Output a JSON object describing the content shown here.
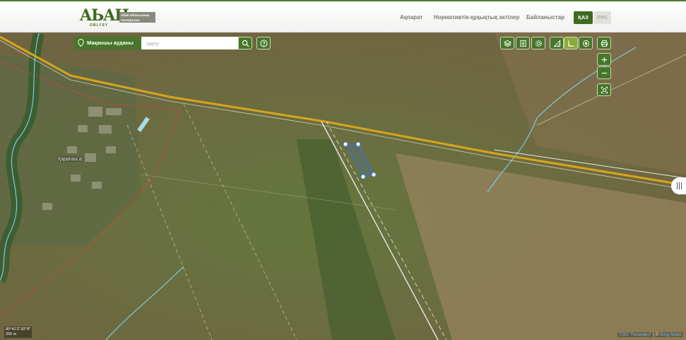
{
  "header": {
    "logo_mark": "AЬAH",
    "logo_sub": "OBLYSY",
    "logo_tag": "Абай облысының геопорталы",
    "nav": [
      "Ақпарат",
      "Нормативтік-құқықтық актілер",
      "Байланыстар"
    ],
    "lang_active": "ҚАЗ",
    "lang_other": "РУС"
  },
  "search": {
    "district": "Мақаншы ауданы",
    "placeholder": "Іздеу"
  },
  "map": {
    "place_label": "Қарағаш а.",
    "scale_coords": "80°41'3\",82°8\"",
    "scale_distance": "200 m",
    "attribution_provider": "ТОО \"Геоинфо\"",
    "attribution_sep": " | © ",
    "attribution_bing": "Bing Maps"
  },
  "tools": {
    "icons": [
      "layers-icon",
      "list-icon",
      "settings-icon",
      "measure-area-icon",
      "measure-angle-icon",
      "location-icon",
      "print-icon",
      "zoom-in-icon",
      "zoom-out-icon",
      "extent-icon",
      "help-icon",
      "search-icon"
    ]
  },
  "colors": {
    "brand": "#47762a",
    "brand_light": "#8caa3c",
    "road": "#d8a41c",
    "river": "#7dcbe0",
    "boundary": "#e04040",
    "parcel": "#3d6fe0"
  }
}
